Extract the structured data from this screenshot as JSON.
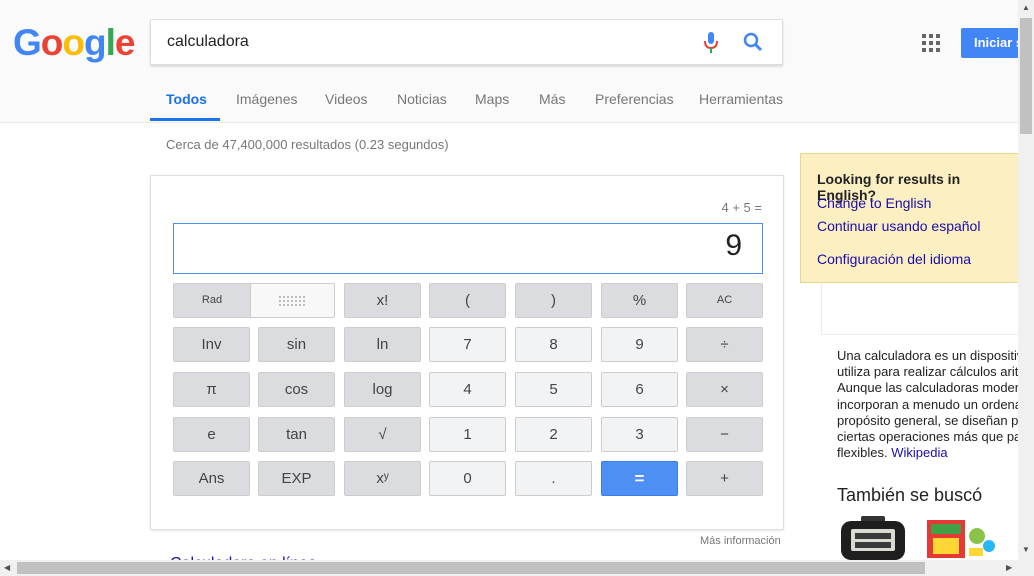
{
  "header": {
    "logo": [
      "G",
      "o",
      "o",
      "g",
      "l",
      "e"
    ],
    "logo_colors": [
      "#4285F4",
      "#EA4335",
      "#FBBC05",
      "#4285F4",
      "#34A853",
      "#EA4335"
    ],
    "query": "calculadora",
    "icons": {
      "mic": "microphone-icon",
      "search": "search-icon",
      "apps": "apps-grid-icon"
    },
    "signin_label": "Iniciar sesión",
    "accent": "#4285F4"
  },
  "tabs": [
    {
      "label": "Todos",
      "active": true
    },
    {
      "label": "Imágenes"
    },
    {
      "label": "Videos"
    },
    {
      "label": "Noticias"
    },
    {
      "label": "Maps"
    },
    {
      "label": "Más"
    },
    {
      "label": "Preferencias"
    },
    {
      "label": "Herramientas"
    }
  ],
  "stats": "Cerca de 47,400,000 resultados (0.23 segundos)",
  "calculator": {
    "expression": "4 + 5 =",
    "result": "9",
    "keys": [
      [
        "Rad",
        "",
        "x!",
        "(",
        ")",
        "%",
        "AC"
      ],
      [
        "Inv",
        "sin",
        "ln",
        "7",
        "8",
        "9",
        "÷"
      ],
      [
        "π",
        "cos",
        "log",
        "4",
        "5",
        "6",
        "×"
      ],
      [
        "e",
        "tan",
        "√",
        "1",
        "2",
        "3",
        "−"
      ],
      [
        "Ans",
        "EXP",
        "xʸ",
        "0",
        ".",
        "=",
        "+"
      ]
    ],
    "more_info": "Más información"
  },
  "language_box": {
    "title": "Looking for results in English?",
    "change": "Change to English",
    "continue": "Continuar usando español",
    "settings": "Configuración del idioma"
  },
  "knowledge_panel": {
    "description_lines": [
      "Una calculadora es un dispositivo",
      "utiliza para realizar cálculos aritméticos.",
      "Aunque las calculadoras modernas",
      "incorporan a menudo un ordenador de",
      "propósito general, se diseñan para",
      "ciertas operaciones más que para ser",
      "flexibles."
    ],
    "wiki_label": "Wikipedia",
    "also_searched": "También se buscó"
  },
  "below": "Calculadora en línea"
}
